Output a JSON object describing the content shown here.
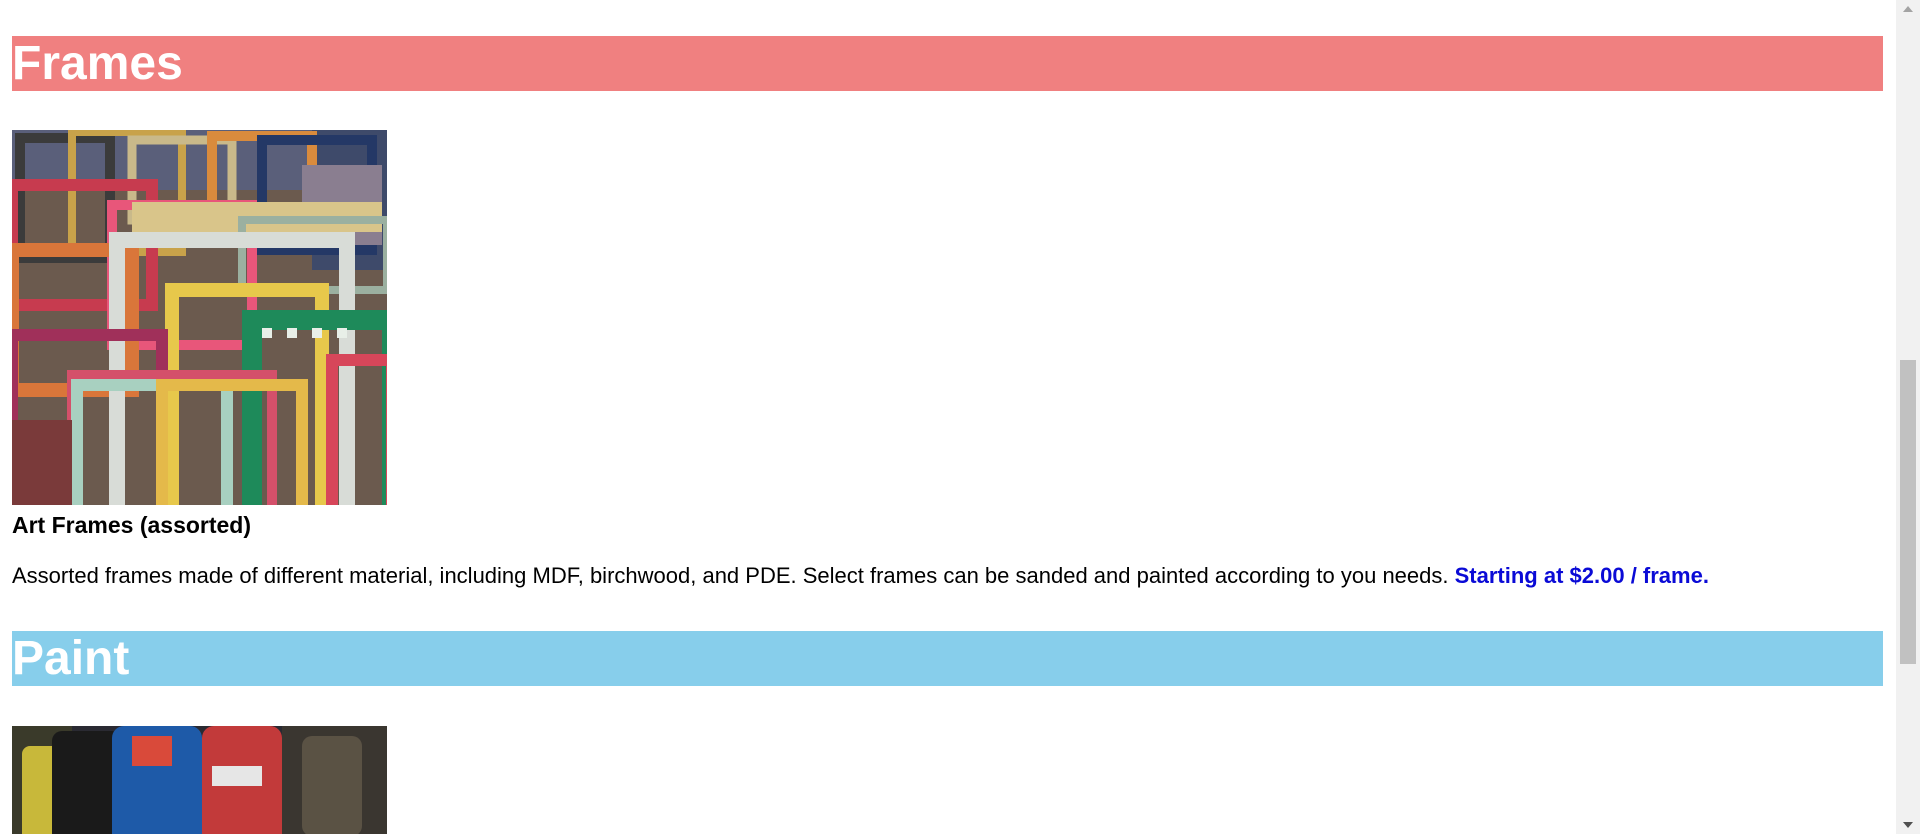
{
  "colors": {
    "frames_header_bg": "#f08080",
    "paint_header_bg": "#87ceeb",
    "price_text": "#0a0ad6"
  },
  "sections": {
    "frames": {
      "title": "Frames",
      "product": {
        "image_alt": "Colorful assorted picture frames",
        "name": "Art Frames (assorted)",
        "description": "Assorted frames made of different material, including MDF, birchwood, and PDE. Select frames can be sanded and painted according to you needs.",
        "price": "Starting at $2.00 / frame."
      }
    },
    "paint": {
      "title": "Paint",
      "product": {
        "image_alt": "Tubes of paint"
      }
    }
  }
}
